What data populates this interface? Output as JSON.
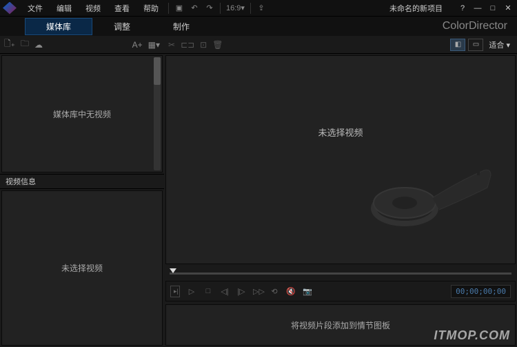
{
  "menu": {
    "file": "文件",
    "edit": "编辑",
    "video": "视频",
    "view": "查看",
    "help": "帮助"
  },
  "titlebar": {
    "ratio": "16:9",
    "project": "未命名的新项目"
  },
  "tabs": {
    "library": "媒体库",
    "adjust": "调整",
    "produce": "制作"
  },
  "brand": "ColorDirector",
  "library": {
    "sort_label": "A+",
    "empty": "媒体库中无视频"
  },
  "info": {
    "header": "视频信息",
    "empty": "未选择视频"
  },
  "preview": {
    "fit": "适合",
    "empty": "未选择视频"
  },
  "transport": {
    "timecode": "00;00;00;00"
  },
  "storyboard": {
    "hint": "将视频片段添加到情节图板"
  },
  "watermark": "ITMOP.COM"
}
